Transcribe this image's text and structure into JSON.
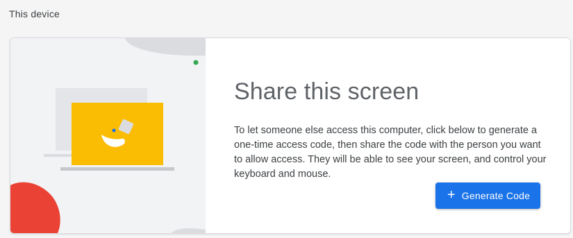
{
  "section": {
    "title": "This device"
  },
  "share_card": {
    "heading": "Share this screen",
    "description": "To let someone else access this computer, click below to generate a one-time access code, then share the code with the person you want to allow access. They will be able to see your screen, and control your keyboard and mouse.",
    "button": {
      "icon": "plus-icon",
      "icon_glyph": "+",
      "label": "Generate Code"
    }
  },
  "colors": {
    "accent": "#1a73e8",
    "illustration_yellow": "#fbbc04",
    "illustration_red": "#ea4335",
    "illustration_green": "#34a853"
  }
}
